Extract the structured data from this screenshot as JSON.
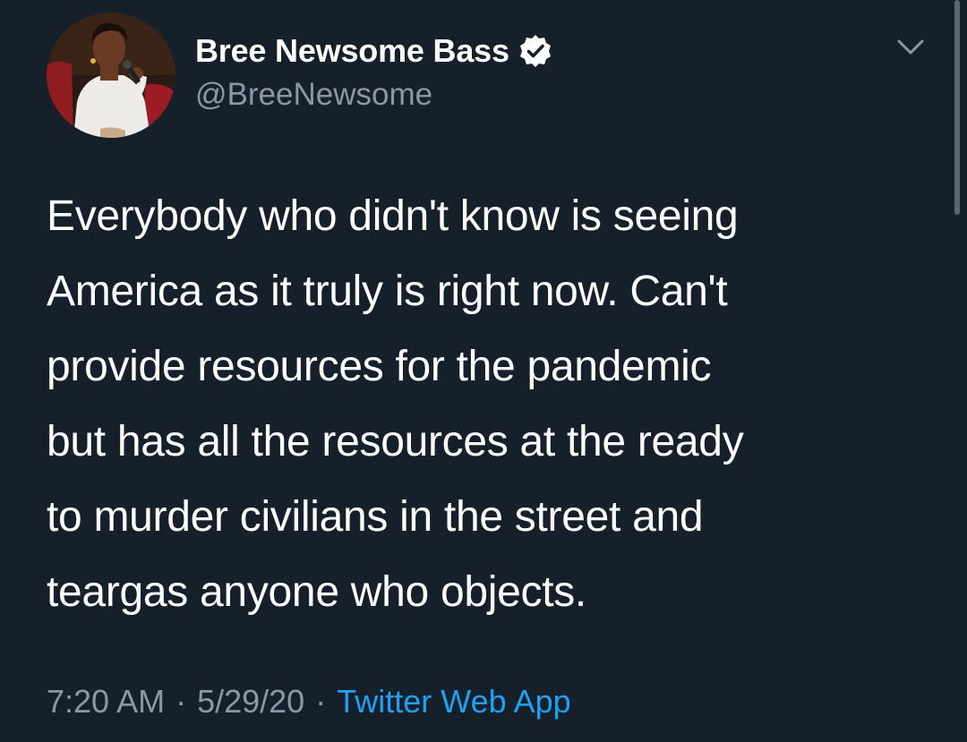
{
  "tweet": {
    "author": {
      "display_name": "Bree Newsome Bass",
      "handle": "@BreeNewsome",
      "verified": true
    },
    "text_lines": [
      "Everybody who didn't know is seeing",
      "America as it truly is right now. Can't",
      "provide resources for the pandemic",
      "but has all the resources at the ready",
      "to murder civilians in the street and",
      "teargas anyone who objects."
    ],
    "time": "7:20 AM",
    "separator": "·",
    "date": "5/29/20",
    "source": "Twitter Web App"
  },
  "icons": {
    "verified": "verified-badge-icon",
    "menu": "chevron-down-icon"
  },
  "colors": {
    "background": "#15202b",
    "primary_text": "#ffffff",
    "secondary_text": "#8899a6",
    "link": "#1da1f2"
  }
}
